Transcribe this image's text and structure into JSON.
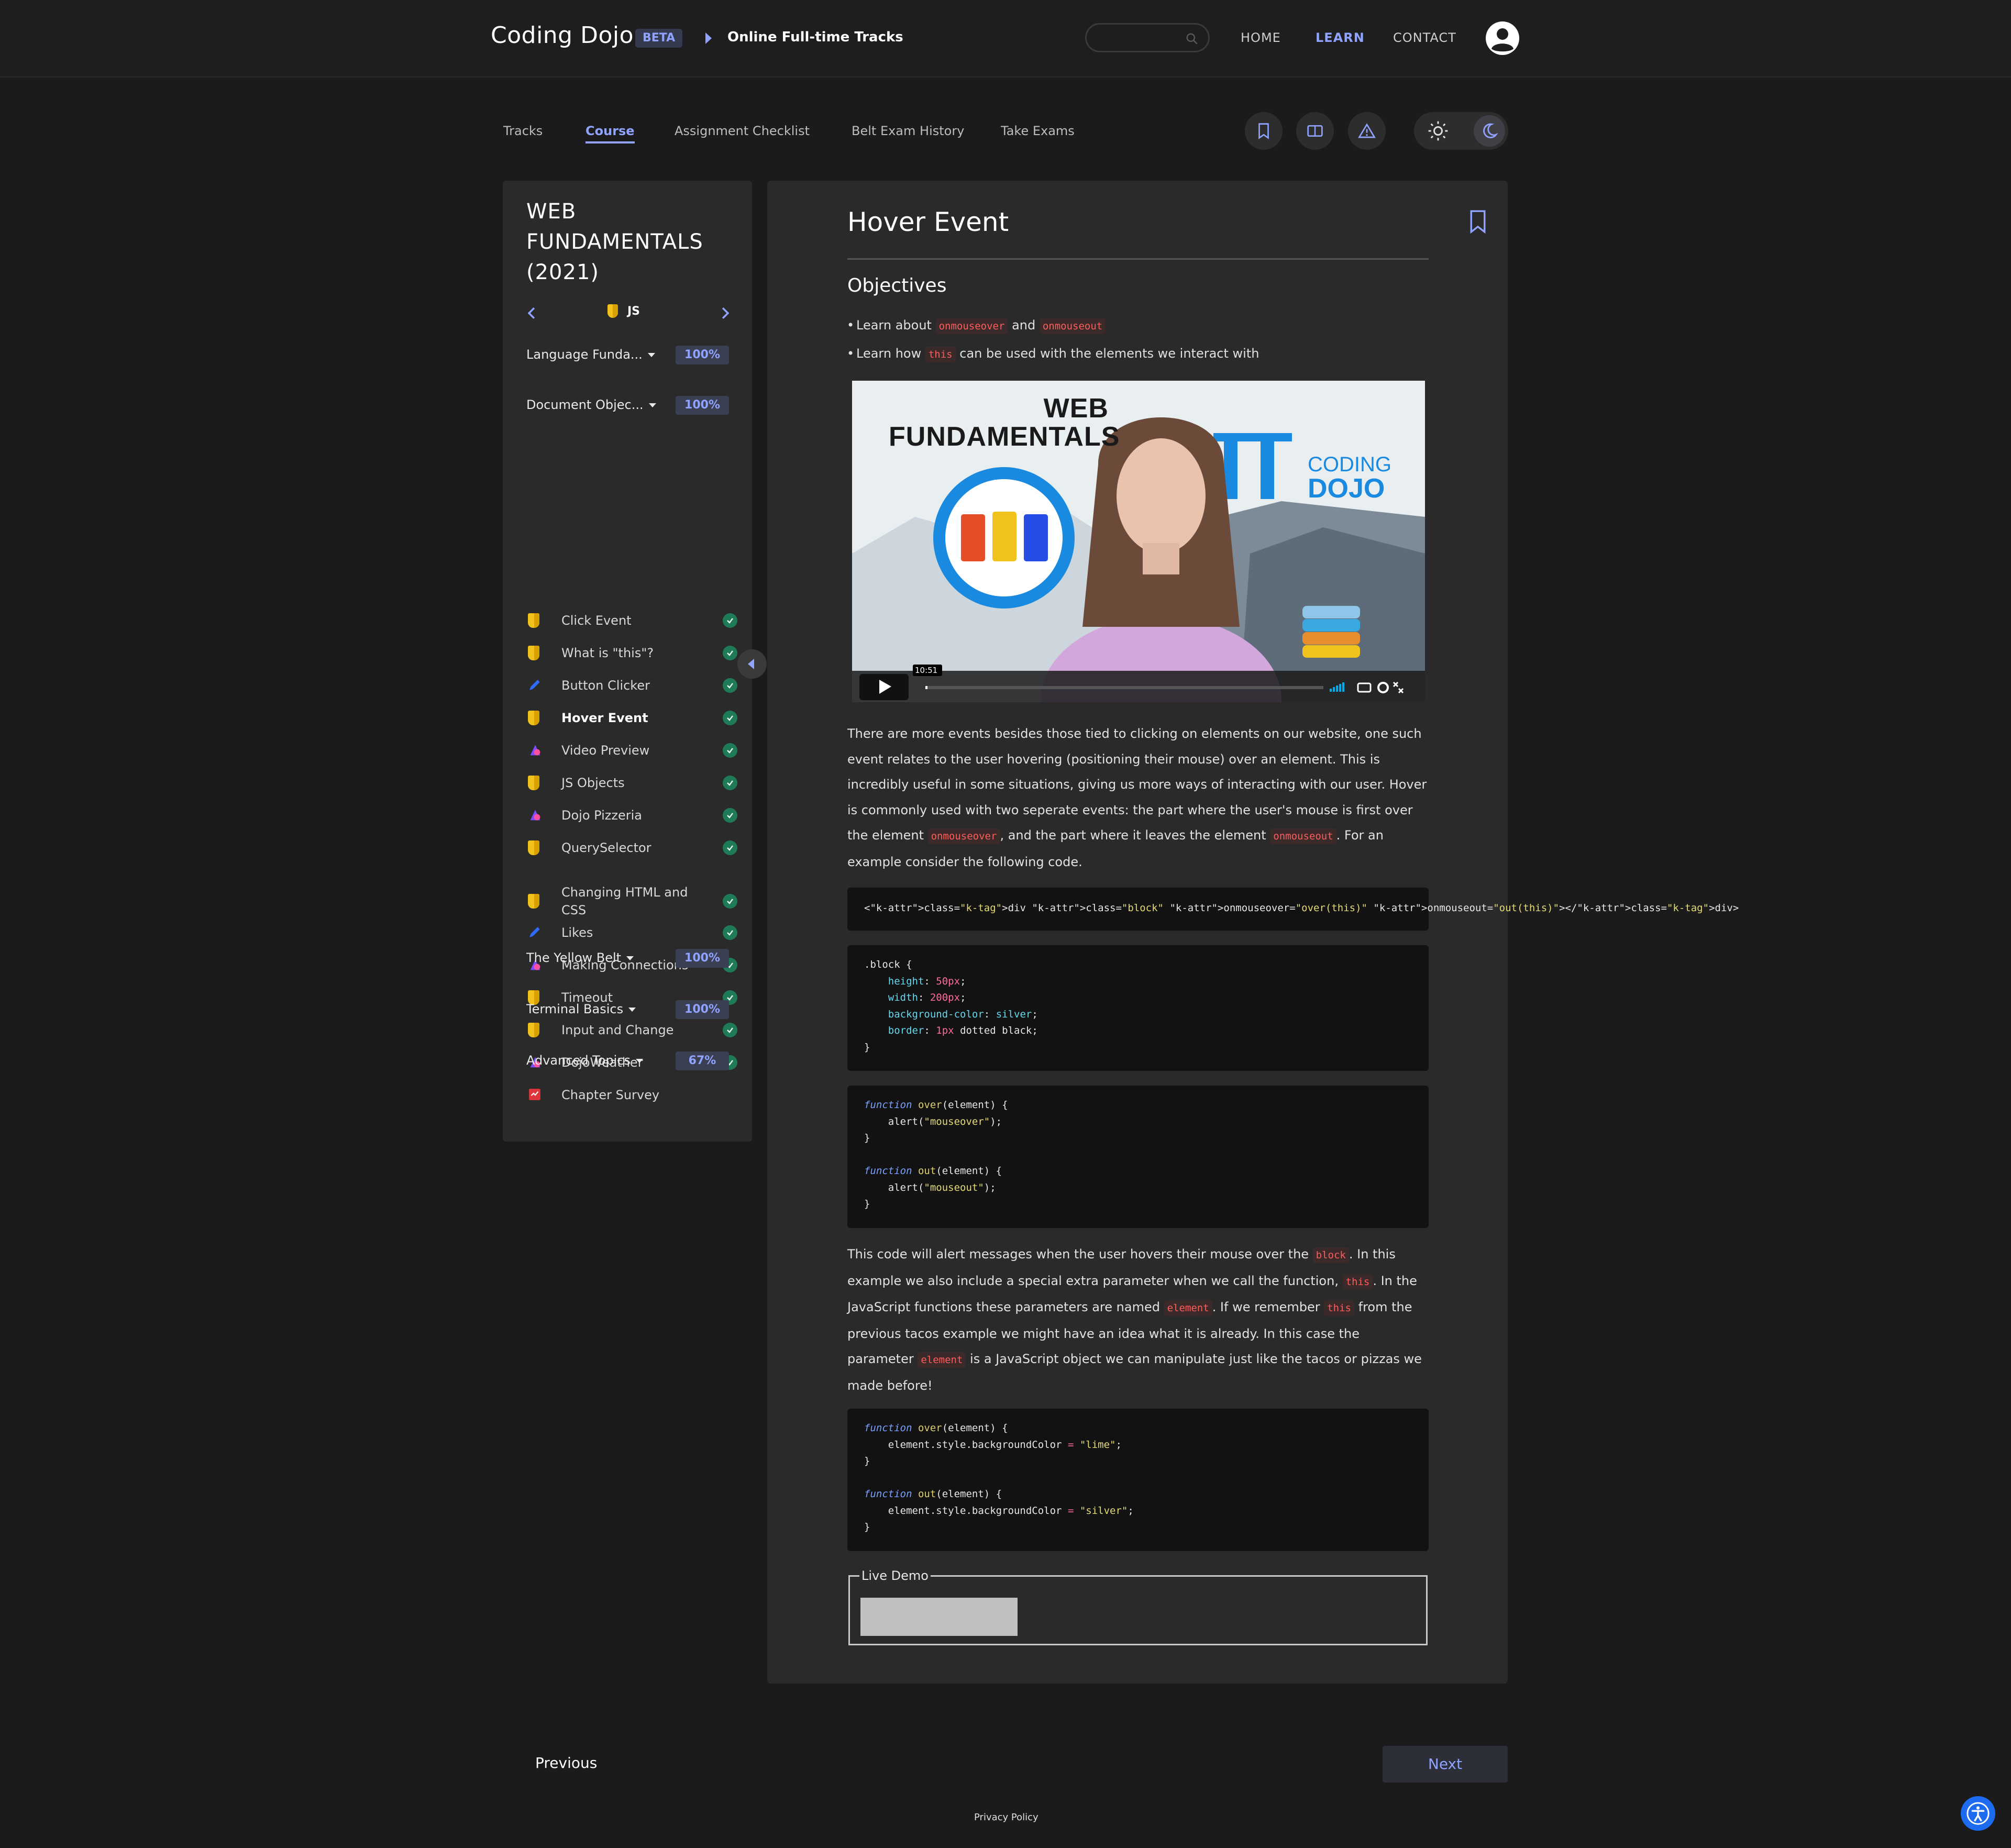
{
  "header": {
    "brand": "Coding Dojo",
    "badge": "BETA",
    "breadcrumb": "Online Full-time Tracks",
    "nav": [
      "HOME",
      "LEARN",
      "CONTACT"
    ],
    "active_nav": "LEARN"
  },
  "tabs": [
    "Tracks",
    "Course",
    "Assignment Checklist",
    "Belt Exam History",
    "Take Exams"
  ],
  "active_tab": "Course",
  "toolbar_icons": [
    "bookmark-icon",
    "book-icon",
    "warning-icon",
    "sun-icon",
    "moon-icon"
  ],
  "sidebar": {
    "course_title": "WEB FUNDAMENTALS (2021)",
    "subnav_label": "JS",
    "sections": [
      {
        "label": "Language Funda...",
        "progress": "100%"
      },
      {
        "label": "Document Objec...",
        "progress": "100%"
      },
      {
        "label": "The Yellow Belt",
        "progress": "100%"
      },
      {
        "label": "Terminal Basics",
        "progress": "100%"
      },
      {
        "label": "Advanced Topics",
        "progress": "67%"
      }
    ],
    "items": [
      {
        "label": "Click Event",
        "icon": "js-icon",
        "done": true
      },
      {
        "label": "What is \"this\"?",
        "icon": "js-icon",
        "done": true
      },
      {
        "label": "Button Clicker",
        "icon": "pencil-icon",
        "done": true
      },
      {
        "label": "Hover Event",
        "icon": "js-icon",
        "done": true,
        "active": true
      },
      {
        "label": "Video Preview",
        "icon": "rocket-icon",
        "done": true
      },
      {
        "label": "JS Objects",
        "icon": "js-icon",
        "done": true
      },
      {
        "label": "Dojo Pizzeria",
        "icon": "rocket-icon",
        "done": true
      },
      {
        "label": "QuerySelector",
        "icon": "js-icon",
        "done": true
      },
      {
        "label": "Changing HTML and CSS",
        "icon": "js-icon",
        "done": true
      },
      {
        "label": "Likes",
        "icon": "pencil-icon",
        "done": true
      },
      {
        "label": "Making Connections",
        "icon": "rocket-icon",
        "done": true
      },
      {
        "label": "Timeout",
        "icon": "js-icon",
        "done": true
      },
      {
        "label": "Input and Change",
        "icon": "js-icon",
        "done": true
      },
      {
        "label": "DojoWeather",
        "icon": "rocket-icon",
        "done": true
      },
      {
        "label": "Chapter Survey",
        "icon": "survey-icon",
        "done": false
      }
    ]
  },
  "lesson": {
    "title": "Hover Event",
    "objectives_heading": "Objectives",
    "objective1": {
      "pre": "Learn about ",
      "code1": "onmouseover",
      "mid": " and ",
      "code2": "onmouseout"
    },
    "objective2": {
      "pre": "Learn how ",
      "code": "this",
      "post": " can be used with the elements we interact with"
    },
    "video": {
      "time": "10:51",
      "banner_left": "WEB FUNDAMENTALS",
      "banner_right_1": "CODING",
      "banner_right_2": "DOJO"
    },
    "para1": {
      "t1": "There are more events besides those tied to clicking on elements on our website, one such event relates to the user hovering (positioning their mouse) over an element. This is incredibly useful in some situations, giving us more ways of interacting with our user. Hover is commonly used with two seperate events: the part where the user's mouse is first over the element ",
      "c1": "onmouseover",
      "t2": ", and the part where it leaves the element ",
      "c2": "onmouseout",
      "t3": ". For an example consider the following code."
    },
    "code1": "<div class=\"block\" onmouseover=\"over(this)\" onmouseout=\"out(this)\"></div>",
    "code2_lines": [
      ".block {",
      "    height: 50px;",
      "    width: 200px;",
      "    background-color: silver;",
      "    border: 1px dotted black;",
      "}"
    ],
    "code3_lines": [
      "function over(element) {",
      "    alert(\"mouseover\");",
      "}",
      "",
      "function out(element) {",
      "    alert(\"mouseout\");",
      "}"
    ],
    "para2": {
      "t1": "This code will alert messages when the user hovers their mouse over the ",
      "c1": "block",
      "t2": ". In this example we also include a special extra parameter when we call the function, ",
      "c2": "this",
      "t3": ". In the JavaScript functions these parameters are named ",
      "c3": "element",
      "t4": ". If we remember ",
      "c4": "this",
      "t5": " from the previous tacos example we might have an idea what it is already. In this case the parameter ",
      "c5": "element",
      "t6": " is a JavaScript object we can manipulate just like the tacos or pizzas we made before!"
    },
    "code4_lines": [
      "function over(element) {",
      "    element.style.backgroundColor = \"lime\";",
      "}",
      "",
      "function out(element) {",
      "    element.style.backgroundColor = \"silver\";",
      "}"
    ],
    "live_demo_label": "Live Demo"
  },
  "footer": {
    "previous": "Previous",
    "next": "Next",
    "privacy": "Privacy Policy"
  },
  "colors": {
    "accent": "#8fa3ff",
    "background": "#1b1b1b",
    "panel": "#2a2a2a",
    "success": "#1f7a57"
  }
}
